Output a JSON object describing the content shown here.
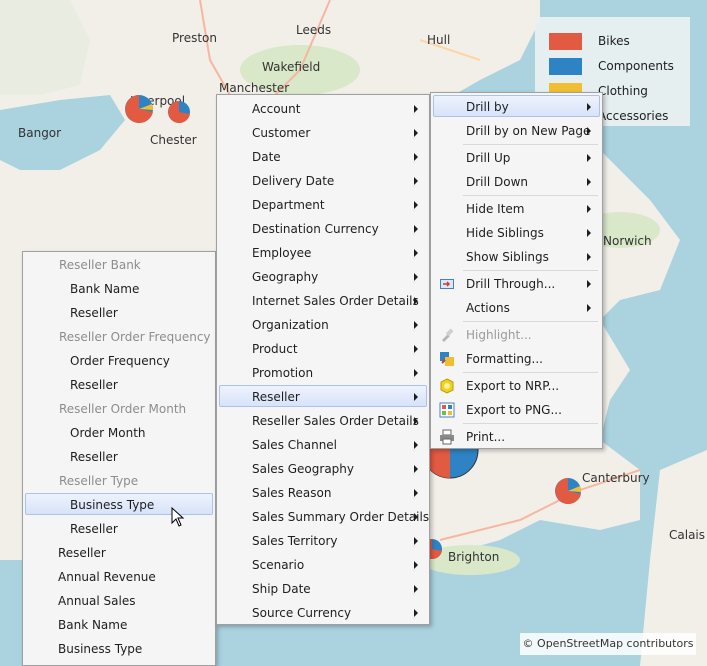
{
  "map": {
    "cities": [
      "Preston",
      "Leeds",
      "Hull",
      "Wakefield",
      "Manchester",
      "Liverpool",
      "Bangor",
      "Chester",
      "Norwich",
      "Canterbury",
      "Brighton",
      "Calais"
    ],
    "credit": "© OpenStreetMap contributors"
  },
  "legend": {
    "items": [
      {
        "label": "Bikes",
        "color": "#e25a42"
      },
      {
        "label": "Components",
        "color": "#2d83c4"
      },
      {
        "label": "Clothing",
        "color": "#f1be32"
      },
      {
        "label": "Accessories",
        "color": "#75b94a"
      }
    ]
  },
  "menu_fields": {
    "items": [
      {
        "label": "Reseller Bank",
        "kind": "header"
      },
      {
        "label": "Bank Name",
        "kind": "item"
      },
      {
        "label": "Reseller",
        "kind": "item"
      },
      {
        "label": "Reseller Order Frequency",
        "kind": "header"
      },
      {
        "label": "Order Frequency",
        "kind": "item"
      },
      {
        "label": "Reseller",
        "kind": "item"
      },
      {
        "label": "Reseller Order Month",
        "kind": "header"
      },
      {
        "label": "Order Month",
        "kind": "item"
      },
      {
        "label": "Reseller",
        "kind": "item"
      },
      {
        "label": "Reseller Type",
        "kind": "header"
      },
      {
        "label": "Business Type",
        "kind": "item",
        "highlighted": true
      },
      {
        "label": "Reseller",
        "kind": "item"
      },
      {
        "label": "Reseller",
        "kind": "attr"
      },
      {
        "label": "Annual Revenue",
        "kind": "attr"
      },
      {
        "label": "Annual Sales",
        "kind": "attr"
      },
      {
        "label": "Bank Name",
        "kind": "attr"
      },
      {
        "label": "Business Type",
        "kind": "attr"
      }
    ]
  },
  "menu_dimensions": {
    "items": [
      {
        "label": "Account"
      },
      {
        "label": "Customer"
      },
      {
        "label": "Date"
      },
      {
        "label": "Delivery Date"
      },
      {
        "label": "Department"
      },
      {
        "label": "Destination Currency"
      },
      {
        "label": "Employee"
      },
      {
        "label": "Geography"
      },
      {
        "label": "Internet Sales Order Details"
      },
      {
        "label": "Organization"
      },
      {
        "label": "Product"
      },
      {
        "label": "Promotion"
      },
      {
        "label": "Reseller",
        "highlighted": true
      },
      {
        "label": "Reseller Sales Order Details"
      },
      {
        "label": "Sales Channel"
      },
      {
        "label": "Sales Geography"
      },
      {
        "label": "Sales Reason"
      },
      {
        "label": "Sales Summary Order Details"
      },
      {
        "label": "Sales Territory"
      },
      {
        "label": "Scenario"
      },
      {
        "label": "Ship Date"
      },
      {
        "label": "Source Currency"
      }
    ]
  },
  "menu_context": {
    "items": [
      {
        "label": "Drill by",
        "submenu": true,
        "highlighted": true
      },
      {
        "label": "Drill by on New Page",
        "submenu": true
      },
      {
        "label": "Drill Up",
        "submenu": true
      },
      {
        "label": "Drill Down",
        "submenu": true
      },
      {
        "label": "Hide Item",
        "submenu": true
      },
      {
        "label": "Hide Siblings",
        "submenu": true
      },
      {
        "label": "Show Siblings",
        "submenu": true
      },
      {
        "label": "Drill Through...",
        "submenu": true,
        "icon": "drill-through-icon"
      },
      {
        "label": "Actions",
        "submenu": true
      },
      {
        "label": "Highlight...",
        "disabled": true,
        "icon": "highlight-brush-icon"
      },
      {
        "label": "Formatting...",
        "icon": "formatting-icon"
      },
      {
        "label": "Export to NRP...",
        "icon": "export-nrp-icon"
      },
      {
        "label": "Export to PNG...",
        "icon": "export-png-icon"
      },
      {
        "label": "Print...",
        "icon": "printer-icon"
      }
    ]
  }
}
